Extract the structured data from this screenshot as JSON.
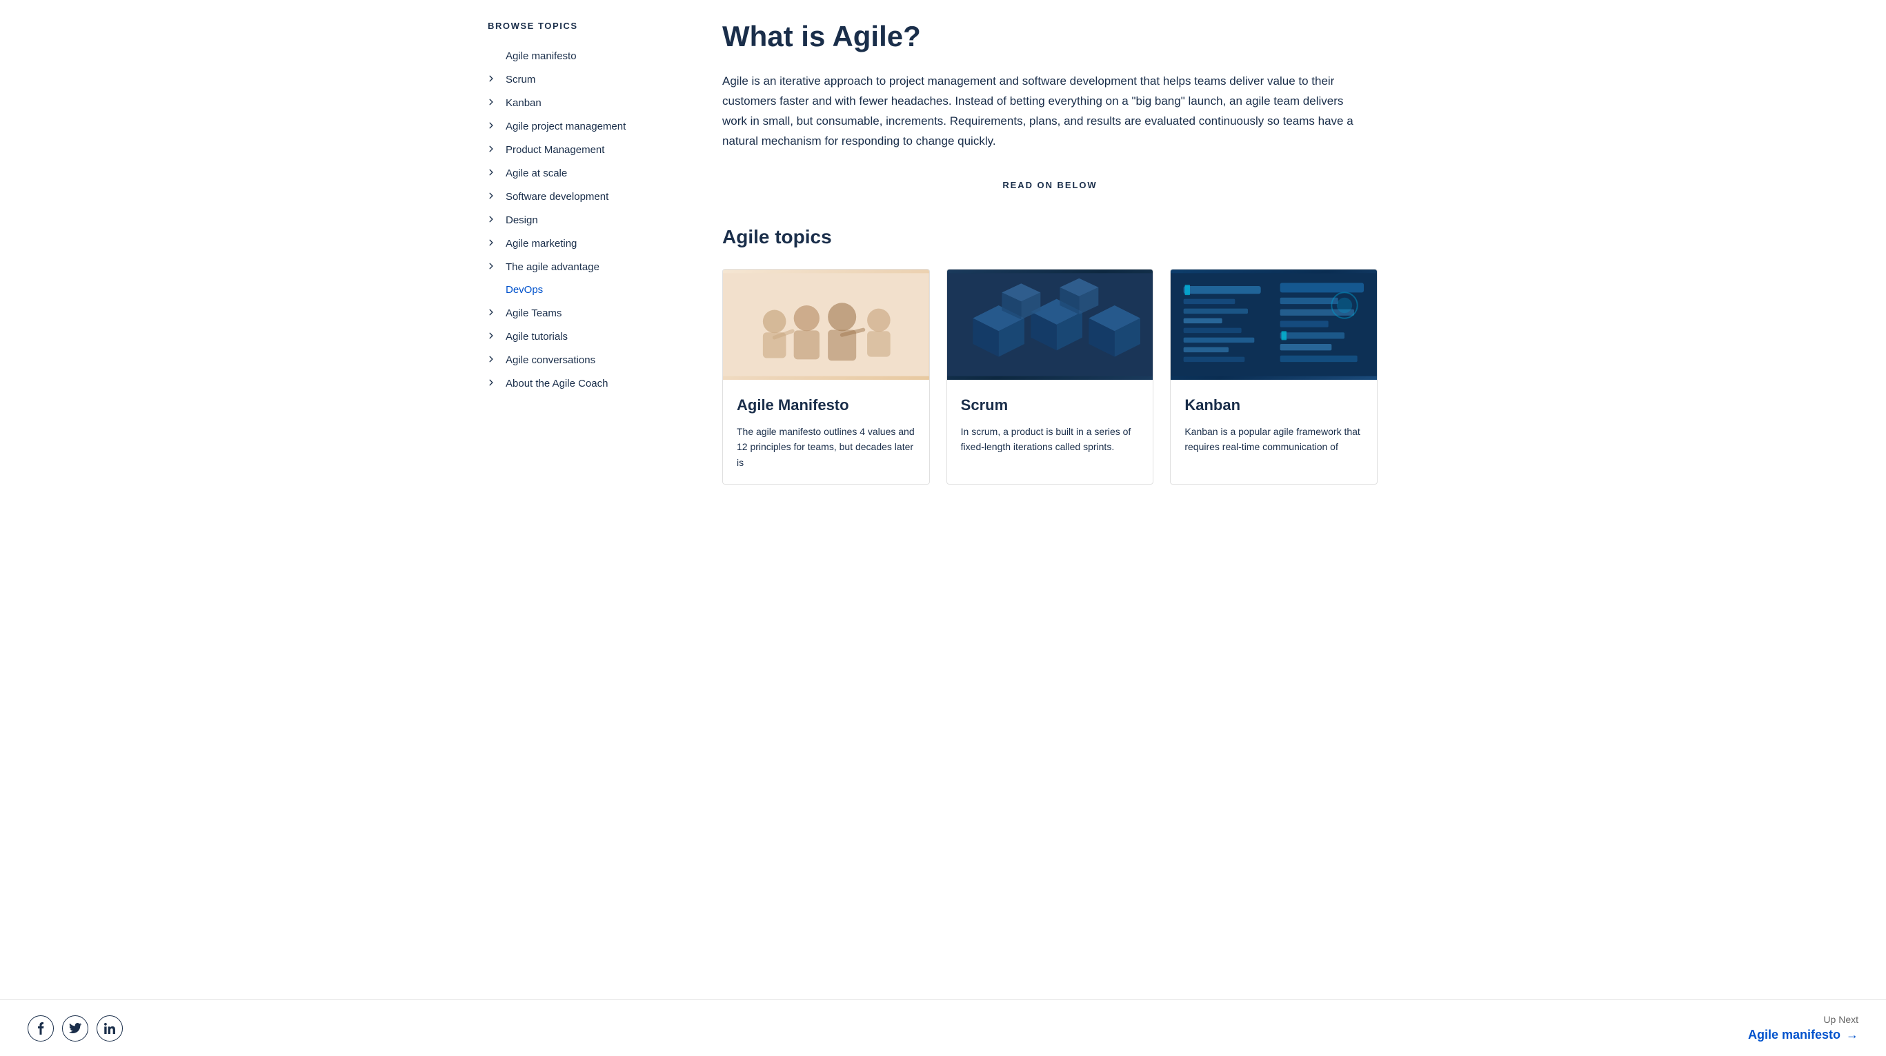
{
  "sidebar": {
    "browse_topics_label": "BROWSE TOPICS",
    "items": [
      {
        "id": "agile-manifesto",
        "label": "Agile manifesto",
        "has_chevron": false,
        "is_devops": false
      },
      {
        "id": "scrum",
        "label": "Scrum",
        "has_chevron": true,
        "is_devops": false
      },
      {
        "id": "kanban",
        "label": "Kanban",
        "has_chevron": true,
        "is_devops": false
      },
      {
        "id": "agile-project-management",
        "label": "Agile project management",
        "has_chevron": true,
        "is_devops": false
      },
      {
        "id": "product-management",
        "label": "Product Management",
        "has_chevron": true,
        "is_devops": false
      },
      {
        "id": "agile-at-scale",
        "label": "Agile at scale",
        "has_chevron": true,
        "is_devops": false
      },
      {
        "id": "software-development",
        "label": "Software development",
        "has_chevron": true,
        "is_devops": false
      },
      {
        "id": "design",
        "label": "Design",
        "has_chevron": true,
        "is_devops": false
      },
      {
        "id": "agile-marketing",
        "label": "Agile marketing",
        "has_chevron": true,
        "is_devops": false
      },
      {
        "id": "the-agile-advantage",
        "label": "The agile advantage",
        "has_chevron": true,
        "is_devops": false
      },
      {
        "id": "devops",
        "label": "DevOps",
        "has_chevron": false,
        "is_devops": true
      },
      {
        "id": "agile-teams",
        "label": "Agile Teams",
        "has_chevron": true,
        "is_devops": false
      },
      {
        "id": "agile-tutorials",
        "label": "Agile tutorials",
        "has_chevron": true,
        "is_devops": false
      },
      {
        "id": "agile-conversations",
        "label": "Agile conversations",
        "has_chevron": true,
        "is_devops": false
      },
      {
        "id": "about-agile-coach",
        "label": "About the Agile Coach",
        "has_chevron": true,
        "is_devops": false
      }
    ]
  },
  "main": {
    "page_title": "What is Agile?",
    "intro_text": "Agile is an iterative approach to project management and software development that helps teams deliver value to their customers faster and with fewer headaches. Instead of betting everything on a \"big bang\" launch, an agile team delivers work in small, but consumable, increments. Requirements, plans, and results are evaluated continuously so teams have a natural mechanism for responding to change quickly.",
    "read_on_below_label": "READ ON BELOW",
    "agile_topics_label": "Agile topics",
    "cards": [
      {
        "id": "agile-manifesto-card",
        "title": "Agile Manifesto",
        "description": "The agile manifesto outlines 4 values and 12 principles for teams, but decades later is",
        "image_type": "manifesto"
      },
      {
        "id": "scrum-card",
        "title": "Scrum",
        "description": "In scrum, a product is built in a series of fixed-length iterations called sprints.",
        "image_type": "scrum"
      },
      {
        "id": "kanban-card",
        "title": "Kanban",
        "description": "Kanban is a popular agile framework that requires real-time communication of",
        "image_type": "kanban"
      }
    ]
  },
  "footer": {
    "social_icons": [
      {
        "id": "facebook-icon",
        "symbol": "f",
        "label": "Facebook"
      },
      {
        "id": "twitter-icon",
        "symbol": "t",
        "label": "Twitter"
      },
      {
        "id": "linkedin-icon",
        "symbol": "in",
        "label": "LinkedIn"
      }
    ],
    "up_next_label": "Up Next",
    "up_next_link_text": "Agile manifesto",
    "up_next_arrow": "→"
  }
}
